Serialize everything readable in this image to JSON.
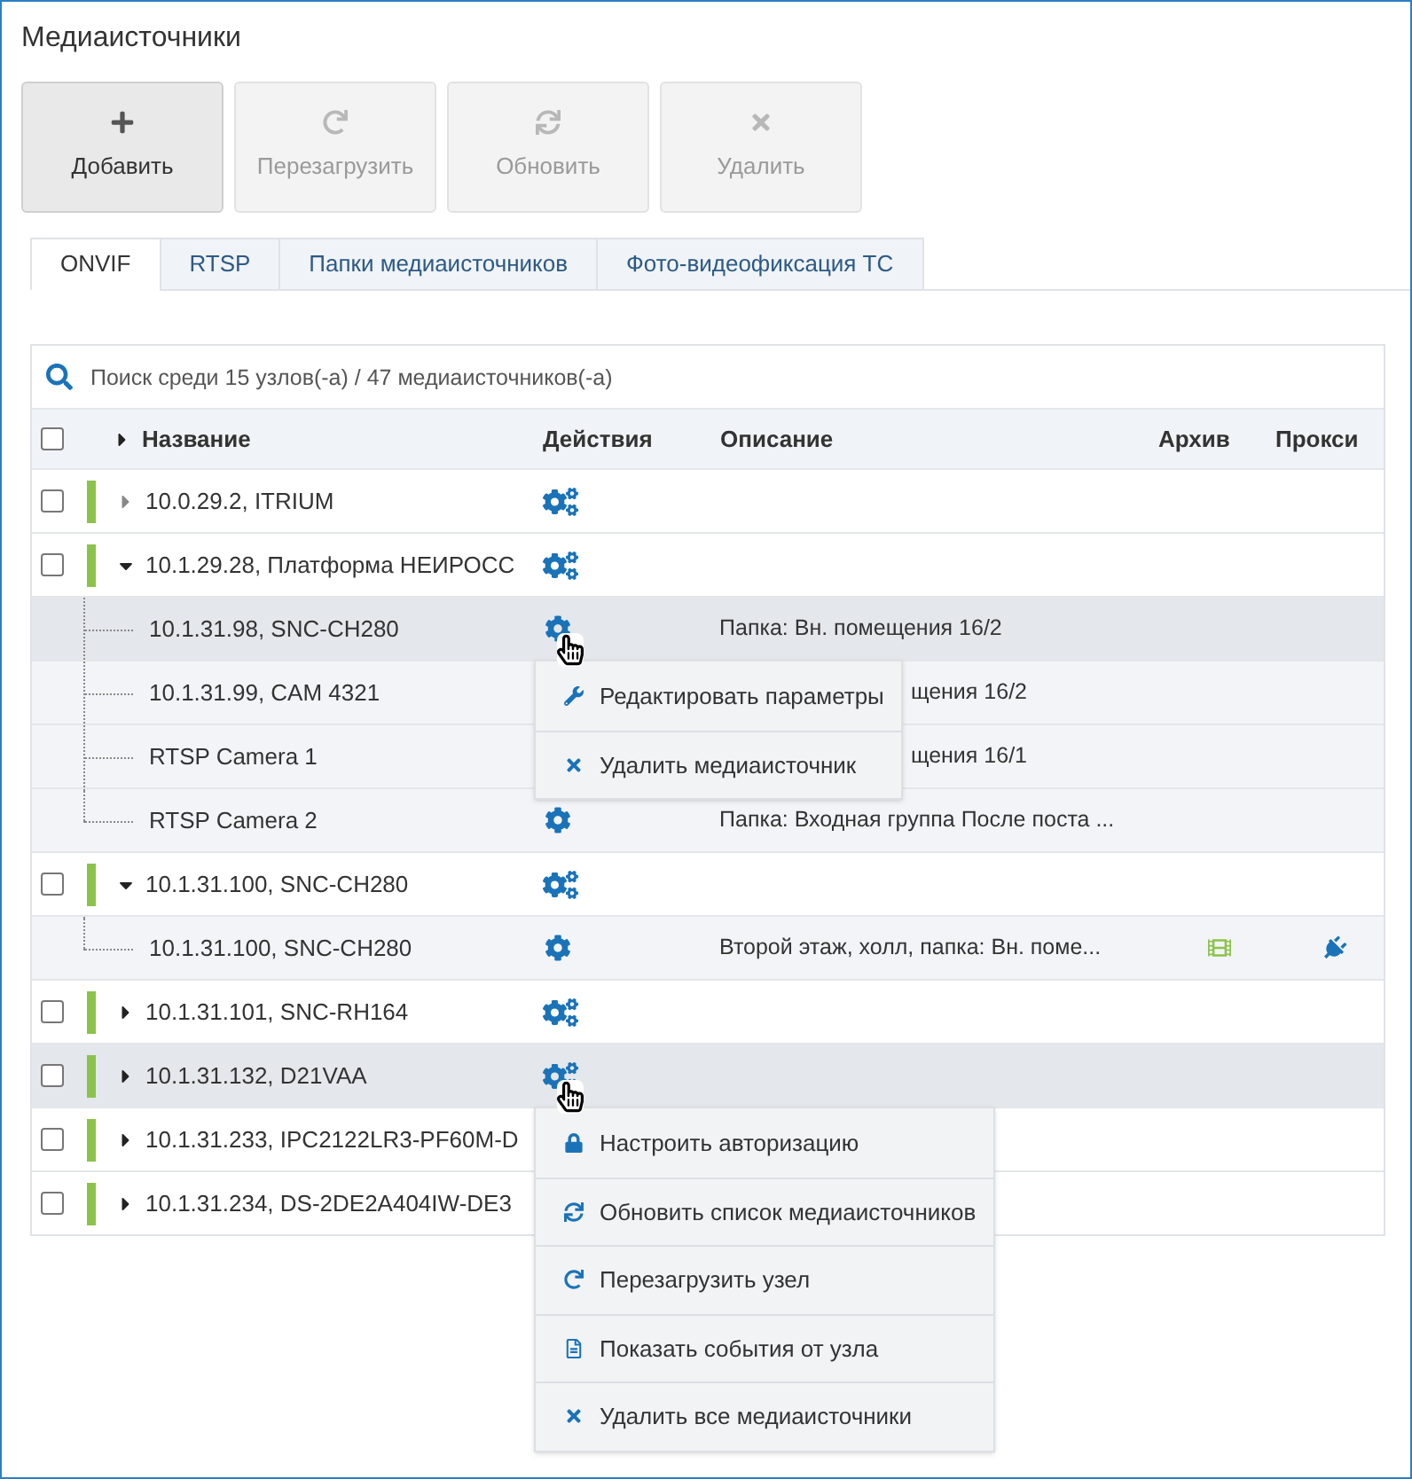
{
  "window": {
    "title": "Медиаисточники"
  },
  "toolbar": [
    {
      "kind": "add",
      "label": "Добавить",
      "disabled": false
    },
    {
      "kind": "reboot",
      "label": "Перезагрузить",
      "disabled": true
    },
    {
      "kind": "refresh",
      "label": "Обновить",
      "disabled": true
    },
    {
      "kind": "delete",
      "label": "Удалить",
      "disabled": true
    }
  ],
  "tabs": [
    {
      "label": "ONVIF",
      "selected": true
    },
    {
      "label": "RTSP",
      "selected": false
    },
    {
      "label": "Папки медиаисточников",
      "selected": false
    },
    {
      "label": "Фото-видеофиксация ТС",
      "selected": false
    }
  ],
  "search": {
    "placeholder": "Поиск среди 15 узлов(-а) / 47 медиаисточников(-а)"
  },
  "table": {
    "header": {
      "checked": false,
      "columns": [
        "Название",
        "Действия",
        "Описание",
        "Архив",
        "Прокси"
      ]
    },
    "rows": [
      {
        "kind": "node",
        "name": "10.0.29.2, ITRIUM",
        "checked": false,
        "expanded": false,
        "caret_dim": true,
        "color": "#8bc34a",
        "action_icon": {
          "kind": "gears"
        },
        "hovered": false
      },
      {
        "kind": "node",
        "name": "10.1.29.28, Платформа НЕИРОСС",
        "checked": false,
        "expanded": true,
        "caret_dim": false,
        "color": "#8bc34a",
        "action_icon": {
          "kind": "gears"
        },
        "hovered": false
      },
      {
        "kind": "source",
        "name": "10.1.31.98, SNC-CH280",
        "action_icon": {
          "kind": "gear"
        },
        "description": "Папка: Вн. помещения 16/2",
        "hovered": true,
        "covered": false,
        "last": false,
        "menu": [
          {
            "kind": "edit",
            "label": "Редактировать параметры"
          },
          {
            "kind": "delete",
            "label": "Удалить медиаисточник"
          }
        ]
      },
      {
        "kind": "source",
        "name": "10.1.31.99, CAM 4321",
        "description": "щения 16/2",
        "hovered": false,
        "covered": true,
        "last": false
      },
      {
        "kind": "source",
        "name": "RTSP Camera 1",
        "description": "щения 16/1",
        "hovered": false,
        "covered": true,
        "last": false
      },
      {
        "kind": "source",
        "name": "RTSP Camera 2",
        "action_icon": {
          "kind": "gear"
        },
        "description": "Папка: Входная группа После поста ...",
        "hovered": false,
        "covered": false,
        "last": true
      },
      {
        "kind": "node",
        "name": "10.1.31.100, SNC-CH280",
        "checked": false,
        "expanded": true,
        "caret_dim": false,
        "color": "#8bc34a",
        "action_icon": {
          "kind": "gears"
        },
        "hovered": false
      },
      {
        "kind": "source",
        "name": "10.1.31.100, SNC-CH280",
        "action_icon": {
          "kind": "gear"
        },
        "description": "Второй этаж, холл, папка: Вн. поме...",
        "hovered": false,
        "covered": false,
        "last": true,
        "archive": true,
        "proxy": true
      },
      {
        "kind": "node",
        "name": "10.1.31.101, SNC-RH164",
        "checked": false,
        "expanded": false,
        "caret_dim": false,
        "color": "#8bc34a",
        "action_icon": {
          "kind": "gears"
        },
        "hovered": false
      },
      {
        "kind": "node",
        "name": "10.1.31.132, D21VAA",
        "checked": false,
        "expanded": false,
        "caret_dim": false,
        "color": "#8bc34a",
        "action_icon": {
          "kind": "gears"
        },
        "hovered": true,
        "menu": [
          {
            "kind": "auth",
            "label": "Настроить авторизацию"
          },
          {
            "kind": "refresh",
            "label": "Обновить список медиаисточников"
          },
          {
            "kind": "reboot",
            "label": "Перезагрузить узел"
          },
          {
            "kind": "events",
            "label": "Показать события от узла"
          },
          {
            "kind": "delete",
            "label": "Удалить все медиаисточники"
          }
        ]
      },
      {
        "kind": "node",
        "name": "10.1.31.233, IPC2122LR3-PF60M-D",
        "checked": false,
        "expanded": false,
        "caret_dim": false,
        "color": "#8bc34a",
        "hovered": false
      },
      {
        "kind": "node",
        "name": "10.1.31.234, DS-2DE2A404IW-DE3",
        "checked": false,
        "expanded": false,
        "caret_dim": false,
        "color": "#8bc34a",
        "hovered": false
      }
    ]
  }
}
